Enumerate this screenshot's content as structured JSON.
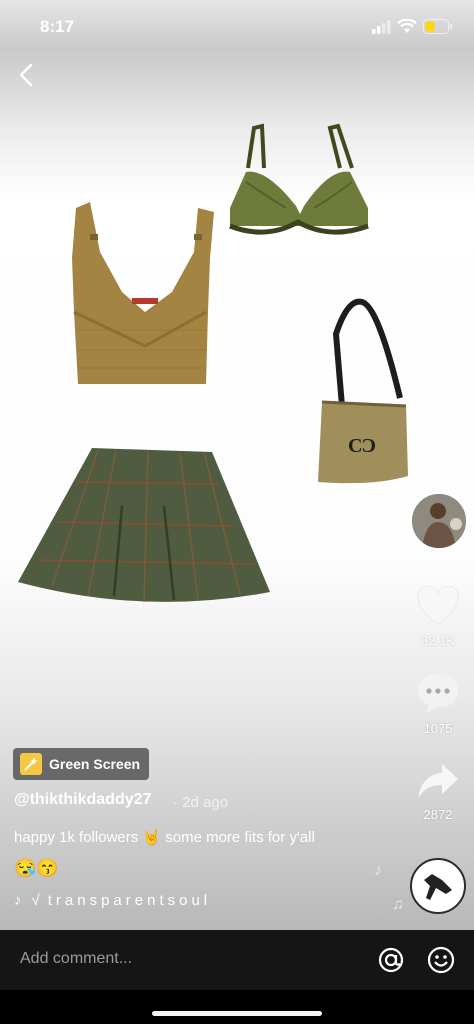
{
  "status_bar": {
    "time": "8:17"
  },
  "nav": {
    "back_icon": "chevron-left-icon"
  },
  "post": {
    "effect_badge": "Green Screen",
    "username": "@thikthikdaddy27",
    "posted": "· 2d ago",
    "caption": "happy 1k followers 🤘 some more fits for y'all",
    "caption_emojis": "😪😙",
    "sound": "transparentsoul"
  },
  "actions": {
    "likes": "82.1K",
    "comments": "1075",
    "shares": "2872"
  },
  "comment_bar": {
    "placeholder": "Add comment..."
  },
  "colors": {
    "top_olive": "#a38442",
    "bra_green": "#6e7b3b",
    "skirt_green": "#4f5c3f",
    "bag_tan": "#a08f5a",
    "badge_yellow": "#f6c744"
  }
}
